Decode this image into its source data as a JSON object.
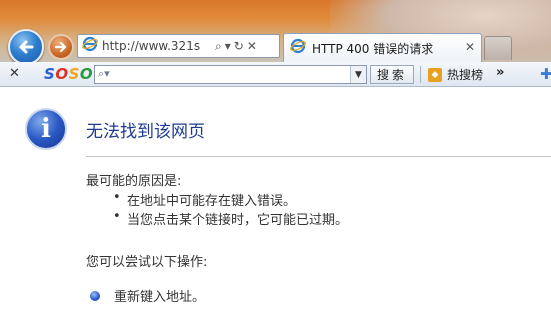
{
  "nav": {
    "url_text": "http://www.321s",
    "search_glyph": "⌕",
    "dropdown_glyph": "▾",
    "refresh_glyph": "↻",
    "stop_glyph": "✕"
  },
  "tab": {
    "title": "HTTP 400 错误的请求",
    "close_glyph": "✕"
  },
  "toolbar": {
    "close_glyph": "✕",
    "brand_letters": [
      "S",
      "O",
      "S",
      "O"
    ],
    "search_placeholder": "",
    "search_button_label": "搜索",
    "hot_search_label": "热搜榜",
    "more_glyph": "»",
    "add_glyph": "✚"
  },
  "content": {
    "title": "无法找到该网页",
    "cause_heading": "最可能的原因是:",
    "causes": [
      "在地址中可能存在键入错误。",
      "当您点击某个链接时，它可能已过期。"
    ],
    "try_heading": "您可以尝试以下操作:",
    "actions": [
      "重新键入地址。"
    ]
  },
  "colors": {
    "title_blue": "#1f3a93",
    "brand_blue": "#2b5fd0",
    "brand_red": "#e0302a",
    "brand_orange": "#f0a520",
    "brand_green": "#2b9a3a"
  }
}
